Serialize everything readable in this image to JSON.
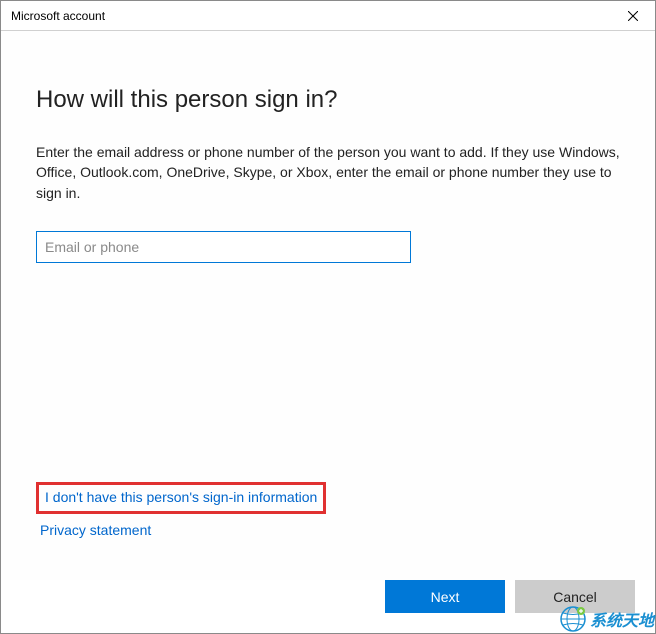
{
  "window": {
    "title": "Microsoft account"
  },
  "content": {
    "heading": "How will this person sign in?",
    "description": "Enter the email address or phone number of the person you want to add. If they use Windows, Office, Outlook.com, OneDrive, Skype, or Xbox, enter the email or phone number they use to sign in.",
    "input_placeholder": "Email or phone",
    "input_value": "",
    "link_no_info": "I don't have this person's sign-in information",
    "link_privacy": "Privacy statement"
  },
  "footer": {
    "next_label": "Next",
    "cancel_label": "Cancel"
  },
  "watermark": {
    "text": "系统天地"
  }
}
